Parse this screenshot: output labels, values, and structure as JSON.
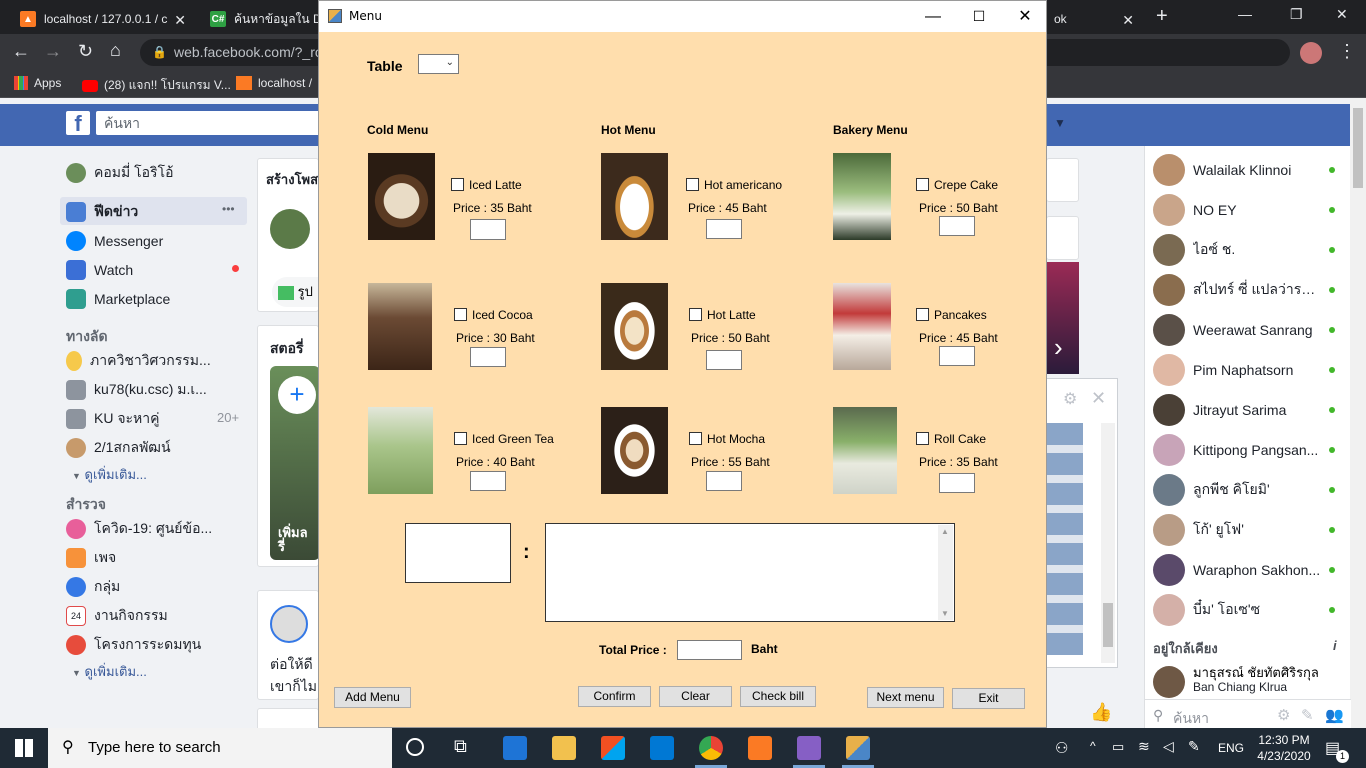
{
  "browser": {
    "tabs": [
      {
        "title": "localhost / 127.0.0.1 / c",
        "favicon": "xampp-icon"
      },
      {
        "title": "ค้นหาข้อมูลใน Dat",
        "favicon": "csharp-icon"
      },
      {
        "title": "ok",
        "favicon": "facebook-icon"
      }
    ],
    "url": "web.facebook.com/?_ro",
    "bookmarks": [
      {
        "label": "Apps"
      },
      {
        "label": "(28) แจก!! โปรแกรม V..."
      },
      {
        "label": "localhost /"
      }
    ]
  },
  "facebook": {
    "search_placeholder": "ค้นหา",
    "left_nav": [
      {
        "label": "คอมมี่ โอริโอ้"
      },
      {
        "label": "ฟีดข่าว",
        "more": "•••"
      },
      {
        "label": "Messenger"
      },
      {
        "label": "Watch"
      },
      {
        "label": "Marketplace"
      }
    ],
    "shortcuts_header": "ทางลัด",
    "shortcuts": [
      {
        "label": "ภาควิชาวิศวกรรม..."
      },
      {
        "label": "ku78(ku.csc) ม.เ..."
      },
      {
        "label": "KU จะหาคู่",
        "badge": "20+"
      },
      {
        "label": "2/1สกลพัฒน์"
      }
    ],
    "see_more": "ดูเพิ่มเติม...",
    "explore_header": "สำรวจ",
    "explore": [
      {
        "label": "โควิด-19: ศูนย์ข้อ..."
      },
      {
        "label": "เพจ"
      },
      {
        "label": "กลุ่ม"
      },
      {
        "label": "งานกิจกรรม"
      },
      {
        "label": "โครงการระดมทุน"
      }
    ],
    "see_more_2": "ดูเพิ่มเติม...",
    "create_post": "สร้างโพส",
    "photo_label": "รูป",
    "stories_header": "สตอรี่",
    "story_text": "เพิ่มล\nรี่",
    "feed_text": "ต่อให้ดี\nเขาก็ไม",
    "contacts": [
      {
        "name": "Walailak Klinnoi"
      },
      {
        "name": "NO EY"
      },
      {
        "name": "ไอซ์ ช."
      },
      {
        "name": "สไปทร์ ซี่ แปลว่ารสจัด"
      },
      {
        "name": "Weerawat Sanrang"
      },
      {
        "name": "Pim Naphatsorn"
      },
      {
        "name": "Jitrayut Sarima"
      },
      {
        "name": "Kittipong Pangsan..."
      },
      {
        "name": "ลูกพีช คิโยมิ'"
      },
      {
        "name": "โก้' ยูโฟ'"
      },
      {
        "name": "Waraphon Sakhon..."
      },
      {
        "name": "บี๋ม' โอเซ'ซ"
      }
    ],
    "nearby_header": "อยู่ใกล้เคียง",
    "nearby": [
      {
        "name": "มาธุสรณ์ ชัยทัตศิริรกุล",
        "sub": "Ban Chiang Klrua"
      }
    ],
    "chat_search": "ค้นหา"
  },
  "app": {
    "title": "Menu",
    "table_label": "Table",
    "sections": [
      {
        "header": "Cold Menu",
        "items": [
          {
            "name": "Iced  Latte",
            "price": "Price :  35 Baht"
          },
          {
            "name": "Iced  Cocoa",
            "price": "Price :  30 Baht"
          },
          {
            "name": "Iced  Green Tea",
            "price": "Price :  40 Baht"
          }
        ]
      },
      {
        "header": "Hot Menu",
        "items": [
          {
            "name": "Hot  americano",
            "price": "Price :  45 Baht"
          },
          {
            "name": "Hot  Latte",
            "price": "Price :  50 Baht"
          },
          {
            "name": "Hot  Mocha",
            "price": "Price :  55 Baht"
          }
        ]
      },
      {
        "header": "Bakery Menu",
        "items": [
          {
            "name": "Crepe  Cake",
            "price": "Price :  50 Baht"
          },
          {
            "name": "Pancakes",
            "price": "Price :  45 Baht"
          },
          {
            "name": "Roll  Cake",
            "price": "Price :  35 Baht"
          }
        ]
      }
    ],
    "colon": ":",
    "total_label": "Total  Price  :",
    "total_unit": "Baht",
    "buttons": {
      "add_menu": "Add Menu",
      "confirm": "Confirm",
      "clear": "Clear",
      "check_bill": "Check bill",
      "next_menu": "Next menu",
      "exit": "Exit"
    }
  },
  "taskbar": {
    "search_placeholder": "Type here to search",
    "language": "ENG",
    "time": "12:30 PM",
    "date": "4/23/2020",
    "notifications": "1"
  }
}
